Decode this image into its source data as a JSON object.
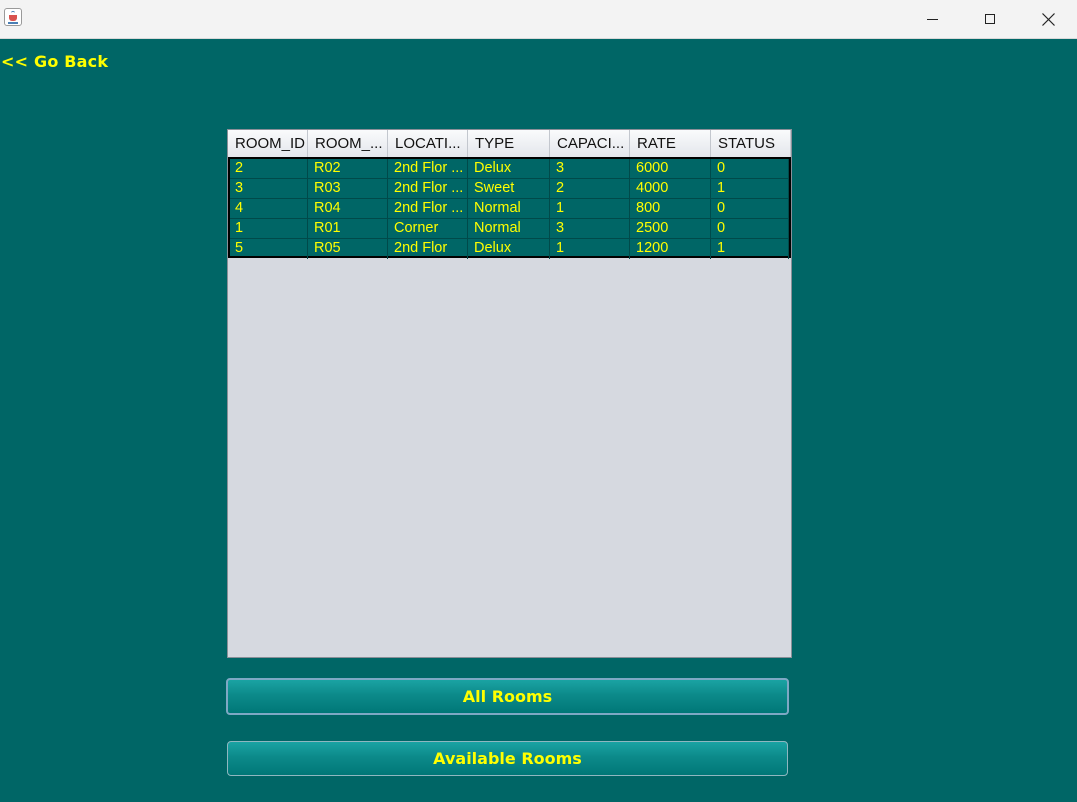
{
  "window": {
    "icons": {
      "app": "java-cup-icon",
      "minimize": "minimize-icon",
      "maximize": "maximize-icon",
      "close": "close-icon"
    }
  },
  "nav": {
    "go_back_label": "<< Go Back"
  },
  "table": {
    "columns": [
      "ROOM_ID",
      "ROOM_...",
      "LOCATI...",
      "TYPE",
      "CAPACI...",
      "RATE",
      "STATUS"
    ],
    "rows": [
      [
        "2",
        "R02",
        "2nd Flor ...",
        "Delux",
        "3",
        "6000",
        "0"
      ],
      [
        "3",
        "R03",
        "2nd Flor ...",
        "Sweet",
        "2",
        "4000",
        "1"
      ],
      [
        "4",
        "R04",
        "2nd Flor ...",
        "Normal",
        "1",
        "800",
        "0"
      ],
      [
        "1",
        "R01",
        "Corner",
        "Normal",
        "3",
        "2500",
        "0"
      ],
      [
        "5",
        "R05",
        "2nd Flor",
        "Delux",
        "1",
        "1200",
        "1"
      ]
    ]
  },
  "buttons": {
    "all_rooms": "All Rooms",
    "available_rooms": "Available Rooms"
  },
  "colors": {
    "background": "#006666",
    "accent_text": "#ffff00",
    "button": "#0c8a8a"
  }
}
